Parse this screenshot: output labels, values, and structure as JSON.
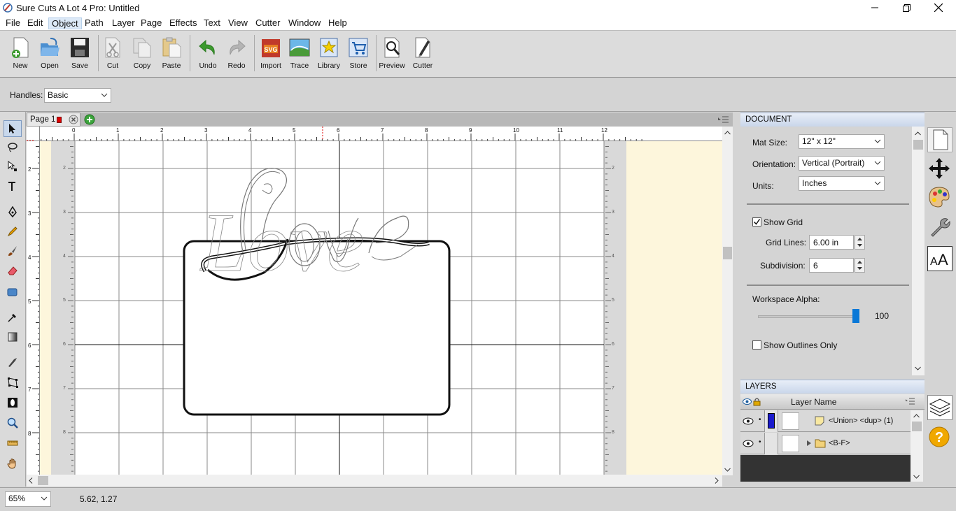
{
  "window": {
    "title": "Sure Cuts A Lot 4 Pro: Untitled",
    "controls": [
      "minimize",
      "maximize",
      "close"
    ]
  },
  "menu": [
    "File",
    "Edit",
    "Object",
    "Path",
    "Layer",
    "Page",
    "Effects",
    "Text",
    "View",
    "Cutter",
    "Window",
    "Help"
  ],
  "menu_active": "Object",
  "toolbar": {
    "new": "New",
    "open": "Open",
    "save": "Save",
    "cut": "Cut",
    "copy": "Copy",
    "paste": "Paste",
    "undo": "Undo",
    "redo": "Redo",
    "import": "Import",
    "trace": "Trace",
    "library": "Library",
    "store": "Store",
    "preview": "Preview",
    "cutter": "Cutter"
  },
  "properties": {
    "handles_label": "Handles:",
    "handles_value": "Basic"
  },
  "tabs": {
    "page_label": "Page 1",
    "page_color": "#e00000"
  },
  "ruler": {
    "h_ticks": [
      "0",
      "1",
      "2",
      "3",
      "4",
      "5",
      "6",
      "7",
      "8",
      "9",
      "10",
      "11",
      "12"
    ],
    "v_ticks": [
      "2",
      "3",
      "4",
      "5",
      "6",
      "7",
      "8"
    ]
  },
  "canvas": {
    "design_text": "Love"
  },
  "status": {
    "zoom": "65%",
    "coords": "5.62, 1.27"
  },
  "document": {
    "header": "DOCUMENT",
    "mat_size_label": "Mat Size:",
    "mat_size": "12\" x 12\"",
    "orientation_label": "Orientation:",
    "orientation": "Vertical (Portrait)",
    "units_label": "Units:",
    "units": "Inches",
    "show_grid_label": "Show Grid",
    "show_grid": true,
    "grid_lines_label": "Grid Lines:",
    "grid_lines": "6.00 in",
    "subdivision_label": "Subdivision:",
    "subdivision": "6",
    "alpha_label": "Workspace Alpha:",
    "alpha_value": "100",
    "alpha_level": 1.0,
    "outlines_label": "Show Outlines Only",
    "outlines": false
  },
  "layers": {
    "header": "LAYERS",
    "column": "Layer Name",
    "items": [
      {
        "name": "<Union> <dup> (1)",
        "color": "#1a1acc"
      },
      {
        "name": "<B-F>",
        "color": ""
      }
    ]
  },
  "colors": {
    "accent": "#0a78d7",
    "workspace_alpha_bg": "#fdf6dc"
  }
}
